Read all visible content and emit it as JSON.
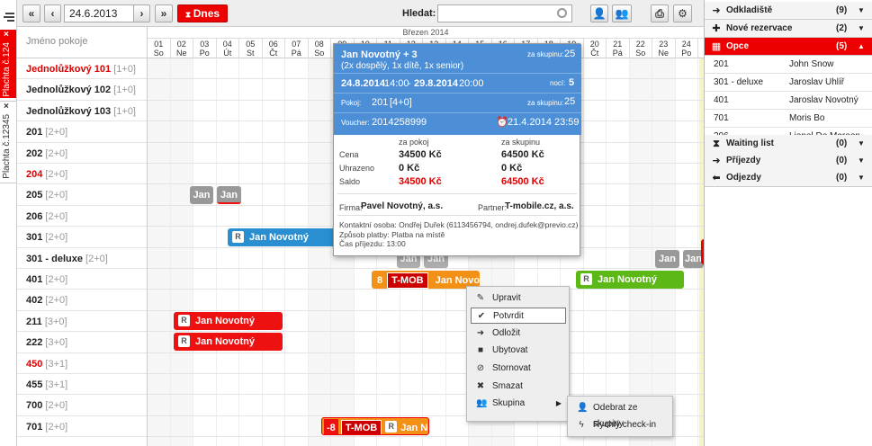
{
  "toolbar": {
    "date": "24.6.2013",
    "today": "Dnes",
    "search_label": "Hledat:",
    "search_value": ""
  },
  "side_tabs": [
    {
      "label": "Plachta č.124"
    },
    {
      "label": "Plachta č.12345"
    }
  ],
  "grid": {
    "name_header": "Jméno pokoje",
    "month": "Březen 2014",
    "days": [
      {
        "n": "01",
        "d": "So"
      },
      {
        "n": "02",
        "d": "Ne"
      },
      {
        "n": "03",
        "d": "Po"
      },
      {
        "n": "04",
        "d": "Út"
      },
      {
        "n": "05",
        "d": "St"
      },
      {
        "n": "06",
        "d": "Čt"
      },
      {
        "n": "07",
        "d": "Pá"
      },
      {
        "n": "08",
        "d": "So"
      },
      {
        "n": "09",
        "d": "Ne"
      },
      {
        "n": "10",
        "d": "Po"
      },
      {
        "n": "11",
        "d": "Út"
      },
      {
        "n": "12",
        "d": "St"
      },
      {
        "n": "13",
        "d": "Čt"
      },
      {
        "n": "14",
        "d": "Pá"
      },
      {
        "n": "15",
        "d": "So"
      },
      {
        "n": "16",
        "d": "Ne"
      },
      {
        "n": "17",
        "d": "Po"
      },
      {
        "n": "18",
        "d": "Út"
      },
      {
        "n": "19",
        "d": "St"
      },
      {
        "n": "20",
        "d": "Čt"
      },
      {
        "n": "21",
        "d": "Pá"
      },
      {
        "n": "22",
        "d": "So"
      },
      {
        "n": "23",
        "d": "Ne"
      },
      {
        "n": "24",
        "d": "Po"
      },
      {
        "n": "25",
        "d": "Út"
      }
    ],
    "rooms": [
      {
        "name": "Jednolůžkový 101",
        "cap": "[1+0]",
        "red": true
      },
      {
        "name": "Jednolůžkový 102",
        "cap": "[1+0]",
        "red": false
      },
      {
        "name": "Jednolůžkový 103",
        "cap": "[1+0]",
        "red": false
      },
      {
        "name": "201",
        "cap": "[2+0]",
        "red": false
      },
      {
        "name": "202",
        "cap": "[2+0]",
        "red": false
      },
      {
        "name": "204",
        "cap": "[2+0]",
        "red": true
      },
      {
        "name": "205",
        "cap": "[2+0]",
        "red": false
      },
      {
        "name": "206",
        "cap": "[2+0]",
        "red": false
      },
      {
        "name": "301",
        "cap": "[2+0]",
        "red": false
      },
      {
        "name": "301 - deluxe",
        "cap": "[2+0]",
        "red": false
      },
      {
        "name": "401",
        "cap": "[2+0]",
        "red": false
      },
      {
        "name": "402",
        "cap": "[2+0]",
        "red": false
      },
      {
        "name": "211",
        "cap": "[3+0]",
        "red": false
      },
      {
        "name": "222",
        "cap": "[3+0]",
        "red": false
      },
      {
        "name": "450",
        "cap": "[3+1]",
        "red": true
      },
      {
        "name": "455",
        "cap": "[3+1]",
        "red": false
      },
      {
        "name": "700",
        "cap": "[2+0]",
        "red": false
      },
      {
        "name": "701",
        "cap": "[2+0]",
        "red": false
      }
    ]
  },
  "reservations": {
    "r205a": "Jan",
    "r205b": "Jan",
    "r301": "Jan Novotný",
    "r301d_a": "Jan",
    "r301d_b": "Jan",
    "r401_num": "8",
    "r401_tm": "T-MOB",
    "r401_name": "Jan Novotn",
    "r401_green": "Jan Novotný",
    "r211": "Jan Novotný",
    "r222": "Jan Novotný",
    "r701_num": "-8",
    "r701_tm": "T-MOB",
    "r701_name": "Jan Nov",
    "r_icon": "R"
  },
  "popup": {
    "guest": "Jan Novotný + 3",
    "guests_detail": "(2x dospělý, 1x dítě, 1x senior)",
    "group_label": "za skupinu:",
    "group_value1": "25",
    "date_from": "24.8.2014",
    "time_from": "14:00",
    "date_to": "29.8.2014",
    "time_to": "20:00",
    "nights_label": "nocí:",
    "nights": "5",
    "rooms_label": "Pokoj:",
    "rooms": "201",
    "rooms_cap": "[4+0]",
    "group_value2": "25",
    "voucher_label": "Voucher:",
    "voucher": "2014258999",
    "deadline": "21.4.2014 23:59",
    "col_room": "za pokoj",
    "col_group": "za skupinu",
    "price_label": "Cena",
    "price_room": "34500 Kč",
    "price_group": "64500 Kč",
    "paid_label": "Uhrazeno",
    "paid_room": "0 Kč",
    "paid_group": "0 Kč",
    "balance_label": "Saldo",
    "balance_room": "34500 Kč",
    "balance_group": "64500 Kč",
    "firm_label": "Firma:",
    "firm": "Pavel Novotný, a.s.",
    "partner_label": "Partner:",
    "partner": "T-mobile.cz, a.s.",
    "contact": "Kontaktní osoba: Ondřej Duřek (6113456794, ondrej.dufek@previo.cz)",
    "payment": "Způsob platby: Platba na místě",
    "arrival": "Čas příjezdu: 13:00"
  },
  "context_menu": {
    "items": [
      "Upravit",
      "Potvrdit",
      "Odložit",
      "Ubytovat",
      "Stornovat",
      "Smazat",
      "Skupina"
    ],
    "submenu": [
      "Odebrat ze skupiny",
      "Rychlý check-in"
    ]
  },
  "right_panel": {
    "odkladiste": {
      "label": "Odkladiště",
      "count": "(9)"
    },
    "nove": {
      "label": "Nové rezervace",
      "count": "(2)"
    },
    "opce": {
      "label": "Opce",
      "count": "(5)"
    },
    "opce_items": [
      {
        "room": "201",
        "name": "John Snow"
      },
      {
        "room": "301 - deluxe",
        "name": "Jaroslav Uhlíř"
      },
      {
        "room": "401",
        "name": "Jaroslav Novotný"
      },
      {
        "room": "701",
        "name": "Moris Bo"
      },
      {
        "room": "206",
        "name": "Lionel De Maroon"
      }
    ],
    "waiting": {
      "label": "Waiting list",
      "count": "(0)"
    },
    "prijezdy": {
      "label": "Příjezdy",
      "count": "(0)"
    },
    "odjezdy": {
      "label": "Odjezdy",
      "count": "(0)"
    }
  },
  "colors": {
    "accent": "#e00000",
    "blue": "#4c8fd6",
    "green": "#5cb817",
    "orange": "#f39016"
  }
}
